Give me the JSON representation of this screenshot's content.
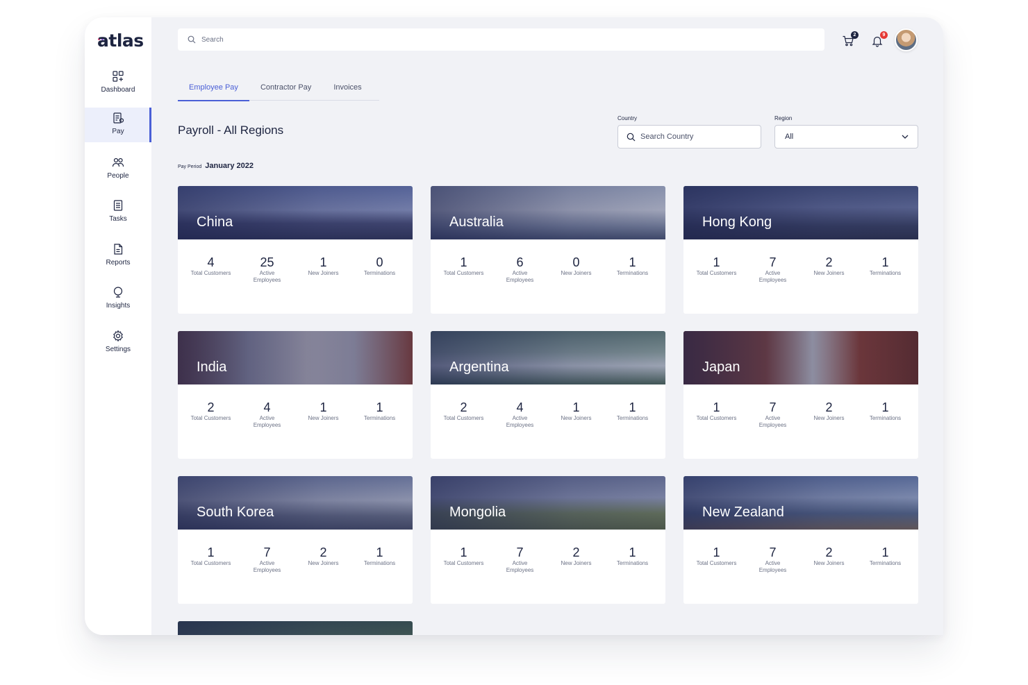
{
  "app": {
    "logo_text": "atlas",
    "logo_dot_colors": [
      "#e8467c",
      "#8a4fe0",
      "#4a5fd6"
    ]
  },
  "colors": {
    "accent": "#4a5fd6",
    "text_primary": "#1d2440",
    "badge_cart": "#1d2440",
    "badge_notifications": "#e53935"
  },
  "sidebar": {
    "items": [
      {
        "label": "Dashboard",
        "icon": "dashboard-icon",
        "active": false
      },
      {
        "label": "Pay",
        "icon": "pay-icon",
        "active": true
      },
      {
        "label": "People",
        "icon": "people-icon",
        "active": false
      },
      {
        "label": "Tasks",
        "icon": "tasks-icon",
        "active": false
      },
      {
        "label": "Reports",
        "icon": "reports-icon",
        "active": false
      },
      {
        "label": "Insights",
        "icon": "insights-icon",
        "active": false
      },
      {
        "label": "Settings",
        "icon": "gear-icon",
        "active": false
      }
    ]
  },
  "topbar": {
    "search_placeholder": "Search",
    "cart_count": "2",
    "notification_count": "9"
  },
  "tabs": [
    {
      "label": "Employee Pay",
      "active": true
    },
    {
      "label": "Contractor Pay",
      "active": false
    },
    {
      "label": "Invoices",
      "active": false
    }
  ],
  "page": {
    "title": "Payroll - All Regions",
    "pay_period_label": "Pay Period",
    "pay_period_value": "January 2022"
  },
  "filters": {
    "country_label": "Country",
    "country_placeholder": "Search Country",
    "region_label": "Region",
    "region_value": "All"
  },
  "stat_labels": {
    "total_customers": "Total Customers",
    "active_employees": "Active Employees",
    "new_joiners": "New Joiners",
    "terminations": "Terminations"
  },
  "countries": [
    {
      "name": "China",
      "total_customers": "4",
      "active_employees": "25",
      "new_joiners": "1",
      "terminations": "0"
    },
    {
      "name": "Australia",
      "total_customers": "1",
      "active_employees": "6",
      "new_joiners": "0",
      "terminations": "1"
    },
    {
      "name": "Hong Kong",
      "total_customers": "1",
      "active_employees": "7",
      "new_joiners": "2",
      "terminations": "1"
    },
    {
      "name": "India",
      "total_customers": "2",
      "active_employees": "4",
      "new_joiners": "1",
      "terminations": "1"
    },
    {
      "name": "Argentina",
      "total_customers": "2",
      "active_employees": "4",
      "new_joiners": "1",
      "terminations": "1"
    },
    {
      "name": "Japan",
      "total_customers": "1",
      "active_employees": "7",
      "new_joiners": "2",
      "terminations": "1"
    },
    {
      "name": "South Korea",
      "total_customers": "1",
      "active_employees": "7",
      "new_joiners": "2",
      "terminations": "1"
    },
    {
      "name": "Mongolia",
      "total_customers": "1",
      "active_employees": "7",
      "new_joiners": "2",
      "terminations": "1"
    },
    {
      "name": "New Zealand",
      "total_customers": "1",
      "active_employees": "7",
      "new_joiners": "2",
      "terminations": "1"
    }
  ]
}
